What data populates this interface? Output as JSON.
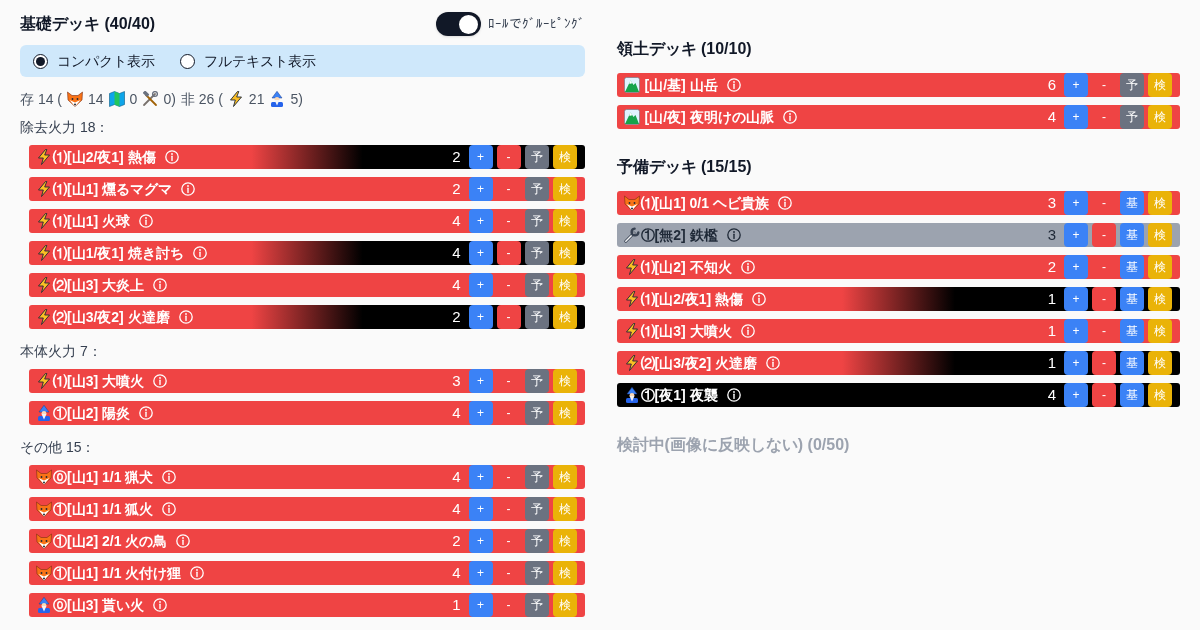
{
  "main_deck": {
    "title": "基礎デッキ (40/40)",
    "grouping_toggle": {
      "label": "ﾛｰﾙでｸﾞﾙｰﾋﾟﾝｸﾞ",
      "on": true
    },
    "view_modes": [
      {
        "label": "コンパクト表示",
        "selected": true
      },
      {
        "label": "フルテキスト表示",
        "selected": false
      }
    ],
    "stats": [
      {
        "label": "存 14 (",
        "items": [
          {
            "kind": "fox",
            "count": "14"
          },
          {
            "kind": "map",
            "count": "0"
          },
          {
            "kind": "tools",
            "count": "0)"
          }
        ]
      },
      {
        "label": "非 26 (",
        "items": [
          {
            "kind": "bolt",
            "count": "21"
          },
          {
            "kind": "wizard",
            "count": "5)"
          }
        ]
      }
    ],
    "groups": [
      {
        "heading": "除去火力 18：",
        "cards": [
          {
            "kind": "bolt",
            "name": "⑴[山2/夜1] 熱傷",
            "color": "#ef4444",
            "fade": {
              "color": "#000000"
            },
            "count": "2",
            "buttons": [
              {
                "label": "+",
                "color": "#3b82f6"
              },
              {
                "label": "-",
                "color": "#ef4444"
              },
              {
                "label": "予",
                "color": "#6b7280"
              },
              {
                "label": "検",
                "color": "#eab308"
              }
            ]
          },
          {
            "kind": "bolt",
            "name": "⑴[山1] 燻るマグマ",
            "color": "#ef4444",
            "count": "2",
            "buttons": [
              {
                "label": "+",
                "color": "#3b82f6"
              },
              {
                "label": "-",
                "color": "#ef4444"
              },
              {
                "label": "予",
                "color": "#6b7280"
              },
              {
                "label": "検",
                "color": "#eab308"
              }
            ]
          },
          {
            "kind": "bolt",
            "name": "⑴[山1] 火球",
            "color": "#ef4444",
            "count": "4",
            "buttons": [
              {
                "label": "+",
                "color": "#3b82f6"
              },
              {
                "label": "-",
                "color": "#ef4444"
              },
              {
                "label": "予",
                "color": "#6b7280"
              },
              {
                "label": "検",
                "color": "#eab308"
              }
            ]
          },
          {
            "kind": "bolt",
            "name": "⑴[山1/夜1] 焼き討ち",
            "color": "#ef4444",
            "fade": {
              "color": "#000000"
            },
            "count": "4",
            "buttons": [
              {
                "label": "+",
                "color": "#3b82f6"
              },
              {
                "label": "-",
                "color": "#ef4444"
              },
              {
                "label": "予",
                "color": "#6b7280"
              },
              {
                "label": "検",
                "color": "#eab308"
              }
            ]
          },
          {
            "kind": "bolt",
            "name": "⑵[山3] 大炎上",
            "color": "#ef4444",
            "count": "4",
            "buttons": [
              {
                "label": "+",
                "color": "#3b82f6"
              },
              {
                "label": "-",
                "color": "#ef4444"
              },
              {
                "label": "予",
                "color": "#6b7280"
              },
              {
                "label": "検",
                "color": "#eab308"
              }
            ]
          },
          {
            "kind": "bolt",
            "name": "⑵[山3/夜2] 火達磨",
            "color": "#ef4444",
            "fade": {
              "color": "#000000"
            },
            "count": "2",
            "buttons": [
              {
                "label": "+",
                "color": "#3b82f6"
              },
              {
                "label": "-",
                "color": "#ef4444"
              },
              {
                "label": "予",
                "color": "#6b7280"
              },
              {
                "label": "検",
                "color": "#eab308"
              }
            ]
          }
        ]
      },
      {
        "heading": "本体火力 7：",
        "cards": [
          {
            "kind": "bolt",
            "name": "⑴[山3] 大噴火",
            "color": "#ef4444",
            "count": "3",
            "buttons": [
              {
                "label": "+",
                "color": "#3b82f6"
              },
              {
                "label": "-",
                "color": "#ef4444"
              },
              {
                "label": "予",
                "color": "#6b7280"
              },
              {
                "label": "検",
                "color": "#eab308"
              }
            ]
          },
          {
            "kind": "wizard",
            "name": "①[山2] 陽炎",
            "color": "#ef4444",
            "count": "4",
            "buttons": [
              {
                "label": "+",
                "color": "#3b82f6"
              },
              {
                "label": "-",
                "color": "#ef4444"
              },
              {
                "label": "予",
                "color": "#6b7280"
              },
              {
                "label": "検",
                "color": "#eab308"
              }
            ]
          }
        ]
      },
      {
        "heading": "その他 15：",
        "cards": [
          {
            "kind": "fox",
            "name": "⓪[山1] 1/1 猟犬",
            "color": "#ef4444",
            "count": "4",
            "buttons": [
              {
                "label": "+",
                "color": "#3b82f6"
              },
              {
                "label": "-",
                "color": "#ef4444"
              },
              {
                "label": "予",
                "color": "#6b7280"
              },
              {
                "label": "検",
                "color": "#eab308"
              }
            ]
          },
          {
            "kind": "fox",
            "name": "①[山1] 1/1 狐火",
            "color": "#ef4444",
            "count": "4",
            "buttons": [
              {
                "label": "+",
                "color": "#3b82f6"
              },
              {
                "label": "-",
                "color": "#ef4444"
              },
              {
                "label": "予",
                "color": "#6b7280"
              },
              {
                "label": "検",
                "color": "#eab308"
              }
            ]
          },
          {
            "kind": "fox",
            "name": "①[山2] 2/1 火の鳥",
            "color": "#ef4444",
            "count": "2",
            "buttons": [
              {
                "label": "+",
                "color": "#3b82f6"
              },
              {
                "label": "-",
                "color": "#ef4444"
              },
              {
                "label": "予",
                "color": "#6b7280"
              },
              {
                "label": "検",
                "color": "#eab308"
              }
            ]
          },
          {
            "kind": "fox",
            "name": "①[山1] 1/1 火付け狸",
            "color": "#ef4444",
            "count": "4",
            "buttons": [
              {
                "label": "+",
                "color": "#3b82f6"
              },
              {
                "label": "-",
                "color": "#ef4444"
              },
              {
                "label": "予",
                "color": "#6b7280"
              },
              {
                "label": "検",
                "color": "#eab308"
              }
            ]
          },
          {
            "kind": "wizard",
            "name": "⓪[山3] 貰い火",
            "color": "#ef4444",
            "count": "1",
            "buttons": [
              {
                "label": "+",
                "color": "#3b82f6"
              },
              {
                "label": "-",
                "color": "#ef4444"
              },
              {
                "label": "予",
                "color": "#6b7280"
              },
              {
                "label": "検",
                "color": "#eab308"
              }
            ]
          }
        ]
      }
    ]
  },
  "side_sections": [
    {
      "title": "領土デッキ (10/10)",
      "disabled": false,
      "cards": [
        {
          "kind": "mountain",
          "name": "[山/基] 山岳",
          "color": "#ef4444",
          "count": "6",
          "buttons": [
            {
              "label": "+",
              "color": "#3b82f6"
            },
            {
              "label": "-",
              "color": "#ef4444"
            },
            {
              "label": "予",
              "color": "#6b7280"
            },
            {
              "label": "検",
              "color": "#eab308"
            }
          ]
        },
        {
          "kind": "mountain",
          "name": "[山/夜] 夜明けの山脈",
          "color": "#ef4444",
          "count": "4",
          "buttons": [
            {
              "label": "+",
              "color": "#3b82f6"
            },
            {
              "label": "-",
              "color": "#ef4444"
            },
            {
              "label": "予",
              "color": "#6b7280"
            },
            {
              "label": "検",
              "color": "#eab308"
            }
          ]
        }
      ]
    },
    {
      "title": "予備デッキ (15/15)",
      "disabled": false,
      "cards": [
        {
          "kind": "fox",
          "name": "⑴[山1] 0/1 ヘビ貴族",
          "color": "#ef4444",
          "count": "3",
          "buttons": [
            {
              "label": "+",
              "color": "#3b82f6"
            },
            {
              "label": "-",
              "color": "#ef4444"
            },
            {
              "label": "基",
              "color": "#3b82f6"
            },
            {
              "label": "検",
              "color": "#eab308"
            }
          ]
        },
        {
          "kind": "wrench",
          "name": "①[無2] 鉄檻",
          "color": "#9ca3af",
          "count": "3",
          "buttons": [
            {
              "label": "+",
              "color": "#3b82f6"
            },
            {
              "label": "-",
              "color": "#ef4444"
            },
            {
              "label": "基",
              "color": "#3b82f6"
            },
            {
              "label": "検",
              "color": "#eab308"
            }
          ]
        },
        {
          "kind": "bolt",
          "name": "⑴[山2] 不知火",
          "color": "#ef4444",
          "count": "2",
          "buttons": [
            {
              "label": "+",
              "color": "#3b82f6"
            },
            {
              "label": "-",
              "color": "#ef4444"
            },
            {
              "label": "基",
              "color": "#3b82f6"
            },
            {
              "label": "検",
              "color": "#eab308"
            }
          ]
        },
        {
          "kind": "bolt",
          "name": "⑴[山2/夜1] 熱傷",
          "color": "#ef4444",
          "fade": {
            "color": "#000000"
          },
          "count": "1",
          "buttons": [
            {
              "label": "+",
              "color": "#3b82f6"
            },
            {
              "label": "-",
              "color": "#ef4444"
            },
            {
              "label": "基",
              "color": "#3b82f6"
            },
            {
              "label": "検",
              "color": "#eab308"
            }
          ]
        },
        {
          "kind": "bolt",
          "name": "⑴[山3] 大噴火",
          "color": "#ef4444",
          "count": "1",
          "buttons": [
            {
              "label": "+",
              "color": "#3b82f6"
            },
            {
              "label": "-",
              "color": "#ef4444"
            },
            {
              "label": "基",
              "color": "#3b82f6"
            },
            {
              "label": "検",
              "color": "#eab308"
            }
          ]
        },
        {
          "kind": "bolt",
          "name": "⑵[山3/夜2] 火達磨",
          "color": "#ef4444",
          "fade": {
            "color": "#000000"
          },
          "count": "1",
          "buttons": [
            {
              "label": "+",
              "color": "#3b82f6"
            },
            {
              "label": "-",
              "color": "#ef4444"
            },
            {
              "label": "基",
              "color": "#3b82f6"
            },
            {
              "label": "検",
              "color": "#eab308"
            }
          ]
        },
        {
          "kind": "wizard",
          "name": "①[夜1] 夜襲",
          "color": "#000000",
          "count": "4",
          "buttons": [
            {
              "label": "+",
              "color": "#3b82f6"
            },
            {
              "label": "-",
              "color": "#ef4444"
            },
            {
              "label": "基",
              "color": "#3b82f6"
            },
            {
              "label": "検",
              "color": "#eab308"
            }
          ]
        }
      ]
    },
    {
      "title": "検討中(画像に反映しない) (0/50)",
      "disabled": true
    }
  ]
}
